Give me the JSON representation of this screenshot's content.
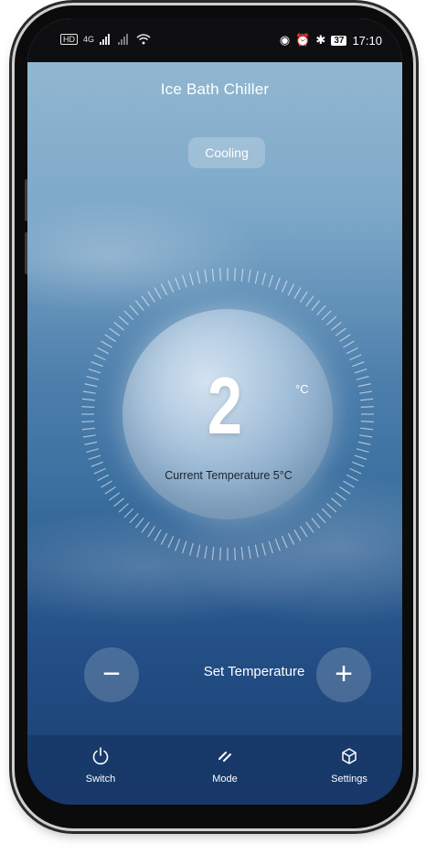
{
  "status_bar": {
    "left_badge": "HD",
    "network": "4G",
    "time": "17:10",
    "battery": "37"
  },
  "header": {
    "title": "Ice Bath Chiller"
  },
  "status_pill": "Cooling",
  "dial": {
    "set_value": "2",
    "unit": "°C",
    "current_temperature": "Current Temperature 5°C"
  },
  "controls": {
    "decrease_label": "−",
    "increase_label": "+",
    "set_label": "Set Temperature"
  },
  "bottom_nav": [
    {
      "label": "Switch",
      "icon": "power-icon"
    },
    {
      "label": "Mode",
      "icon": "mode-icon"
    },
    {
      "label": "Settings",
      "icon": "settings-cube-icon"
    }
  ]
}
